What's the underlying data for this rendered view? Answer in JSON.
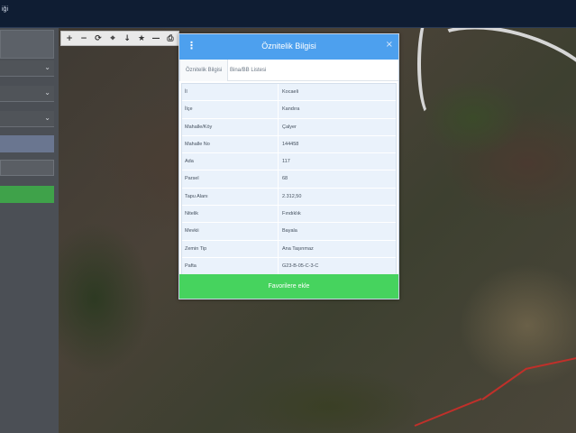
{
  "topbar": {
    "label": "iği"
  },
  "toolbar": {
    "icons": [
      "plus-icon",
      "minus-icon",
      "refresh-icon",
      "locate-icon",
      "info-icon",
      "star-icon",
      "measure-icon",
      "print-icon"
    ],
    "glyphs": [
      "+",
      "−",
      "⟳",
      "⌖",
      "↓",
      "★",
      "—",
      "⎙"
    ]
  },
  "modal": {
    "title": "Öznitelik Bilgisi",
    "menu_glyph": "⋮",
    "close_glyph": "×",
    "tabs": [
      {
        "label": "Öznitelik Bilgisi",
        "active": true
      },
      {
        "label": "Bina/BB Listesi",
        "active": false
      }
    ],
    "rows": [
      {
        "key": "İl",
        "value": "Kocaeli"
      },
      {
        "key": "İlçe",
        "value": "Kandıra"
      },
      {
        "key": "Mahalle/Köy",
        "value": "Çalyer"
      },
      {
        "key": "Mahalle No",
        "value": "144458"
      },
      {
        "key": "Ada",
        "value": "117"
      },
      {
        "key": "Parsel",
        "value": "68"
      },
      {
        "key": "Tapu Alanı",
        "value": "2.312,50"
      },
      {
        "key": "Nitelik",
        "value": "Fındıklık"
      },
      {
        "key": "Mevkii",
        "value": "Bayala"
      },
      {
        "key": "Zemin Tip",
        "value": "Ana Taşınmaz"
      },
      {
        "key": "Pafta",
        "value": "G23-B-05-C-3-C"
      }
    ],
    "fav_button": "Favorilere ekle"
  },
  "colors": {
    "header": "#4da0ee",
    "fav_button": "#46d35e",
    "sidebar_green": "#3fa24a",
    "topbar": "#0f1d33"
  }
}
